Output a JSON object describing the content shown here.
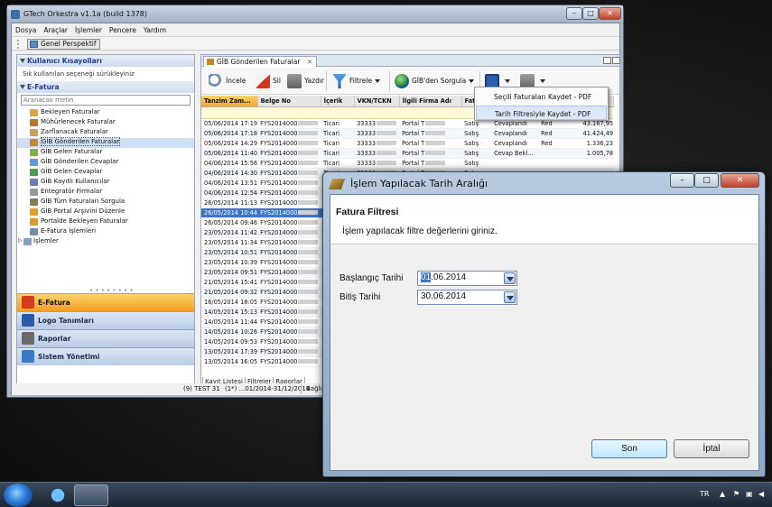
{
  "main_window": {
    "title": "GTech Orkestra v1.1a (build 1378)",
    "controls": {
      "minimize": "–",
      "maximize": "□",
      "close": "✕"
    }
  },
  "menu": [
    "Dosya",
    "Araçlar",
    "İşlemler",
    "Pencere",
    "Yardım"
  ],
  "perspective_button": "Genel Perspektif",
  "left_panel": {
    "shortcuts_header": "Kullanıcı Kısayolları",
    "shortcuts_hint": "Sık kullanılan seçeneği sürükleyiniz",
    "efatura_header": "E-Fatura",
    "search_placeholder": "Aranacak metin",
    "tree": [
      {
        "label": "Bekleyen Faturalar",
        "color": "#d9a441"
      },
      {
        "label": "Mühürlenecek Faturalar",
        "color": "#b8732c"
      },
      {
        "label": "Zarflanacak Faturalar",
        "color": "#c9a062"
      },
      {
        "label": "GİB Gönderilen Faturalar",
        "color": "#c68a2a"
      },
      {
        "label": "GİB Gelen Faturalar",
        "color": "#7fb24a"
      },
      {
        "label": "GİB Gönderilen Cevaplar",
        "color": "#5d9bd6"
      },
      {
        "label": "GİB Gelen Cevaplar",
        "color": "#4f9a4f"
      },
      {
        "label": "GİB Kayıtlı Kullanıcılar",
        "color": "#6a7fb0"
      },
      {
        "label": "Entegratör Firmalar",
        "color": "#9a9a9a"
      },
      {
        "label": "GİB Tüm Faturaları Sorgula",
        "color": "#8a7a5a"
      },
      {
        "label": "GİB Portal Arşivini Düzenle",
        "color": "#e0a030"
      },
      {
        "label": "Portalde Bekleyen Faturalar",
        "color": "#d99a2e"
      },
      {
        "label": "E-Fatura İşlemleri",
        "color": "#7a8aa0"
      },
      {
        "label": "İşlemler",
        "color": "#8aa0c0"
      }
    ],
    "selected_item": "GİB Gönderilen Faturalar",
    "nav_buttons": [
      {
        "label": "E-Fatura",
        "color": "#d23a1e"
      },
      {
        "label": "Logo Tanımları",
        "color": "#2a5aa8"
      },
      {
        "label": "Raporlar",
        "color": "#6a6a6a"
      },
      {
        "label": "Sistem Yönetimi",
        "color": "#3a78c8"
      }
    ]
  },
  "right_panel": {
    "tab_label": "GİB Gönderilen Faturalar",
    "toolbar": {
      "incele": "İncele",
      "sil": "Sil",
      "yazdir": "Yazdır",
      "filtrele": "Filtrele",
      "gib_sorgula": "GİB'den Sorgula"
    },
    "columns": [
      "Tanzim Zam...",
      "Belge No",
      "İçerik",
      "VKN/TCKN",
      "İlgili Firma Adı",
      "Fatu",
      "",
      "",
      ""
    ],
    "rows": [
      [
        "05/06/2014 17:19",
        "FYS2014000",
        "Ticari",
        "33333",
        "Portal T",
        "Satış",
        "Cevaplandı",
        "Red",
        "43.167,95"
      ],
      [
        "05/06/2014 17:18",
        "FYS2014000",
        "Ticari",
        "33333",
        "Portal T",
        "Satış",
        "Cevaplandı",
        "Red",
        "41.424,49"
      ],
      [
        "05/06/2014 14:29",
        "FYS2014000",
        "Ticari",
        "33333",
        "Portal T",
        "Satış",
        "Cevaplandı",
        "Red",
        "1.336,23"
      ],
      [
        "05/06/2014 11:40",
        "FYS2014000",
        "Ticari",
        "33333",
        "Portal T",
        "Satış",
        "Cevap Bekl...",
        "",
        "1.005,78"
      ],
      [
        "04/06/2014 15:56",
        "FYS2014000",
        "Ticari",
        "33333",
        "Portal T",
        "Satış",
        "",
        "",
        ""
      ],
      [
        "04/06/2014 14:30",
        "FYS2014000",
        "Ticari",
        "33333",
        "Portal T",
        "Satış",
        "",
        "",
        ""
      ],
      [
        "04/06/2014 13:51",
        "FYS2014000",
        "Ticari",
        "33333",
        "Portal T",
        "",
        "",
        "",
        ""
      ],
      [
        "04/06/2014 12:54",
        "FYS2014000",
        "Ticari",
        "33333",
        "Portal T",
        "",
        "",
        "",
        ""
      ],
      [
        "26/05/2014 11:13",
        "FYS2014000",
        "Ticari",
        "33333",
        "Portal T",
        "",
        "",
        "",
        ""
      ],
      [
        "26/05/2014 10:44",
        "FYS2014000",
        "Ticari",
        "33333",
        "Portal T",
        "",
        "",
        "",
        ""
      ],
      [
        "26/05/2014 09:46",
        "FYS2014000",
        "Ticari",
        "33333",
        "Portal T",
        "",
        "",
        "",
        ""
      ],
      [
        "23/05/2014 11:42",
        "FYS2014000",
        "Ticari",
        "33333",
        "Portal T",
        "",
        "",
        "",
        ""
      ],
      [
        "23/05/2014 11:34",
        "FYS2014000",
        "Ticari",
        "33333",
        "Portal T",
        "",
        "",
        "",
        ""
      ],
      [
        "23/05/2014 10:51",
        "FYS2014000",
        "Ticari",
        "33333",
        "Portal T",
        "",
        "",
        "",
        ""
      ],
      [
        "23/05/2014 10:39",
        "FYS2014000",
        "Ticari",
        "33333",
        "Portal T",
        "",
        "",
        "",
        ""
      ],
      [
        "23/05/2014 09:51",
        "FYS2014000",
        "Ticari",
        "33333",
        "Portal T",
        "",
        "",
        "",
        ""
      ],
      [
        "21/05/2014 15:41",
        "FYS2014000",
        "Ticari",
        "33333",
        "Portal T",
        "",
        "",
        "",
        ""
      ],
      [
        "21/05/2014 09:32",
        "FYS2014000",
        "Ticari",
        "33333",
        "Portal T",
        "",
        "",
        "",
        ""
      ],
      [
        "16/05/2014 18:05",
        "FYS2014000",
        "Ticari",
        "33333",
        "Portal T",
        "",
        "",
        "",
        ""
      ],
      [
        "14/05/2014 15:13",
        "FYS2014000",
        "Ticari",
        "33333",
        "Portal T",
        "",
        "",
        "",
        ""
      ],
      [
        "14/05/2014 11:44",
        "FYS2014000",
        "Ticari",
        "33333",
        "Portal T",
        "",
        "",
        "",
        ""
      ],
      [
        "14/05/2014 10:26",
        "FYS2014000",
        "Ticari",
        "33333",
        "Portal T",
        "",
        "",
        "",
        ""
      ],
      [
        "14/05/2014 09:53",
        "FYS2014000",
        "Ticari",
        "33333",
        "Portal T",
        "",
        "",
        "",
        ""
      ],
      [
        "13/05/2014 17:39",
        "FYS2014000",
        "Ticari",
        "33333",
        "Portal T",
        "",
        "",
        "",
        ""
      ],
      [
        "13/05/2014 16:05",
        "FYS2014000",
        "Ticari",
        "33333",
        "Portal T",
        "",
        "",
        "",
        ""
      ]
    ],
    "selected_row_index": 9,
    "bottom_tabs": [
      "Kayıt Listesi",
      "Filtreler",
      "Raporlar"
    ]
  },
  "status_bar": {
    "company": "(9) TEST 31",
    "period": "(1*) ...01/2014-31/12/2014",
    "connection": "Bağlı D"
  },
  "popup_menu": [
    "Seçili Faturaları Kaydet - PDF",
    "Tarih Filtresiyle Kaydet - PDF"
  ],
  "dialog": {
    "title": "İşlem Yapılacak Tarih Aralığı",
    "header_title": "Fatura Filtresi",
    "header_subtitle": "İşlem yapılacak filtre değerlerini giriniz.",
    "start_label": "Başlangıç Tarihi",
    "start_value_sel": "01",
    "start_value_rest": ".06.2014",
    "end_label": "Bitiş Tarihi",
    "end_value": "30.06.2014",
    "ok_button": "Son",
    "cancel_button": "İptal"
  },
  "taskbar": {
    "language": "TR"
  }
}
